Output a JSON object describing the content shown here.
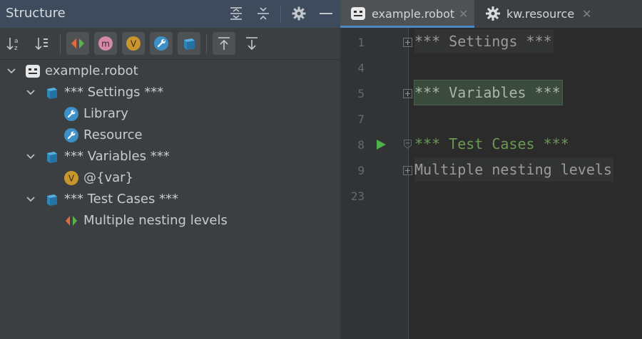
{
  "structure": {
    "title": "Structure",
    "header_icons": [
      "expand-all-icon",
      "collapse-all-icon",
      "gear-icon",
      "minimize-icon"
    ],
    "toolbar_icons": [
      "sort-alphabetically-icon",
      "sort-by-type-icon",
      "show-test-cases-icon",
      "show-keywords-icon",
      "show-variables-icon",
      "show-imports-icon",
      "show-sections-icon",
      "navigate-from-source-icon",
      "navigate-to-source-icon"
    ],
    "tree": {
      "root": "example.robot",
      "settings": "*** Settings ***",
      "library": "Library",
      "resource": "Resource",
      "variables": "*** Variables ***",
      "var": "@{var}",
      "test_cases": "*** Test Cases ***",
      "test_case": "Multiple nesting levels"
    }
  },
  "editor": {
    "tabs": [
      {
        "label": "example.robot",
        "close": "✕"
      },
      {
        "label": "kw.resource",
        "close": "✕"
      }
    ],
    "lines": [
      {
        "num": "1",
        "text": "*** Settings ***"
      },
      {
        "num": "4",
        "text": ""
      },
      {
        "num": "5",
        "text": "*** Variables ***"
      },
      {
        "num": "7",
        "text": ""
      },
      {
        "num": "8",
        "text": "*** Test Cases ***"
      },
      {
        "num": "9",
        "text": "Multiple nesting levels"
      },
      {
        "num": "23",
        "text": ""
      }
    ]
  },
  "colors": {
    "panel_bg": "#3c3f41",
    "header_bg": "#3d4b5c",
    "editor_bg": "#2b2b2b",
    "accent_blue": "#4a88c7",
    "section_green": "#6a9955"
  }
}
